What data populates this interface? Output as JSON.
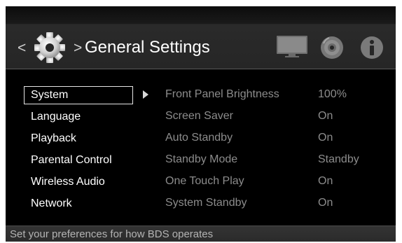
{
  "header": {
    "back_symbol": "<",
    "separator_symbol": ">",
    "title": "General Settings"
  },
  "menu": {
    "selected_index": 0,
    "items": [
      {
        "label": "System"
      },
      {
        "label": "Language"
      },
      {
        "label": "Playback"
      },
      {
        "label": "Parental Control"
      },
      {
        "label": "Wireless Audio"
      },
      {
        "label": "Network"
      }
    ]
  },
  "options": [
    {
      "label": "Front Panel Brightness",
      "value": "100%"
    },
    {
      "label": "Screen Saver",
      "value": "On"
    },
    {
      "label": "Auto Standby",
      "value": "On"
    },
    {
      "label": "Standby Mode",
      "value": "Standby"
    },
    {
      "label": "One Touch Play",
      "value": "On"
    },
    {
      "label": "System Standby",
      "value": "On"
    }
  ],
  "footer": {
    "hint": "Set your preferences for how BDS operates"
  },
  "icons": {
    "settings": "gear-icon",
    "display": "tv-icon",
    "disc": "disc-icon",
    "info": "info-icon"
  },
  "colors": {
    "background": "#000000",
    "header": "#262626",
    "active_text": "#ffffff",
    "inactive_text": "#8c8c8c",
    "selection_border": "#e6e6e6"
  }
}
